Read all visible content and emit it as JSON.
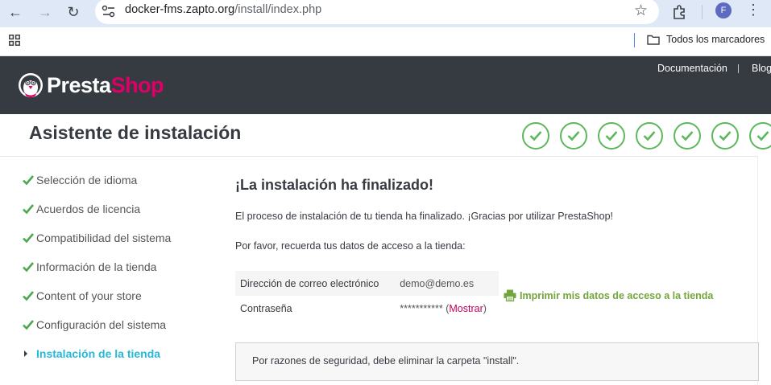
{
  "browser": {
    "url_host": "docker-fms.zapto.org",
    "url_path": "/install/index.php",
    "profile_initial": "F",
    "bookmarks_label": "Todos los marcadores"
  },
  "header": {
    "logo_part1": "Presta",
    "logo_part2": "Shop",
    "links": [
      "Documentación",
      "Blog"
    ],
    "brand_color": "#df0067",
    "bg_color": "#363a41"
  },
  "page": {
    "title": "Asistente de instalación",
    "steps_completed": 7
  },
  "sidebar": {
    "items": [
      {
        "label": "Selección de idioma",
        "state": "done"
      },
      {
        "label": "Acuerdos de licencia",
        "state": "done"
      },
      {
        "label": "Compatibilidad del sistema",
        "state": "done"
      },
      {
        "label": "Información de la tienda",
        "state": "done"
      },
      {
        "label": "Content of your store",
        "state": "done"
      },
      {
        "label": "Configuración del sistema",
        "state": "done"
      },
      {
        "label": "Instalación de la tienda",
        "state": "current"
      }
    ]
  },
  "main": {
    "heading": "¡La instalación ha finalizado!",
    "message": "El proceso de instalación de tu tienda ha finalizado. ¡Gracias por utilizar PrestaShop!",
    "reminder": "Por favor, recuerda tus datos de acceso a la tienda:",
    "credentials": {
      "email_label": "Dirección de correo electrónico",
      "email_value": "demo@demo.es",
      "password_label": "Contraseña",
      "password_value": "***********",
      "show_open": " (",
      "show_link": "Mostrar",
      "show_close": ")"
    },
    "print_link": "Imprimir mis datos de acceso a la tienda",
    "security_notice": "Por razones de seguridad, debe eliminar la carpeta \"install\"."
  }
}
